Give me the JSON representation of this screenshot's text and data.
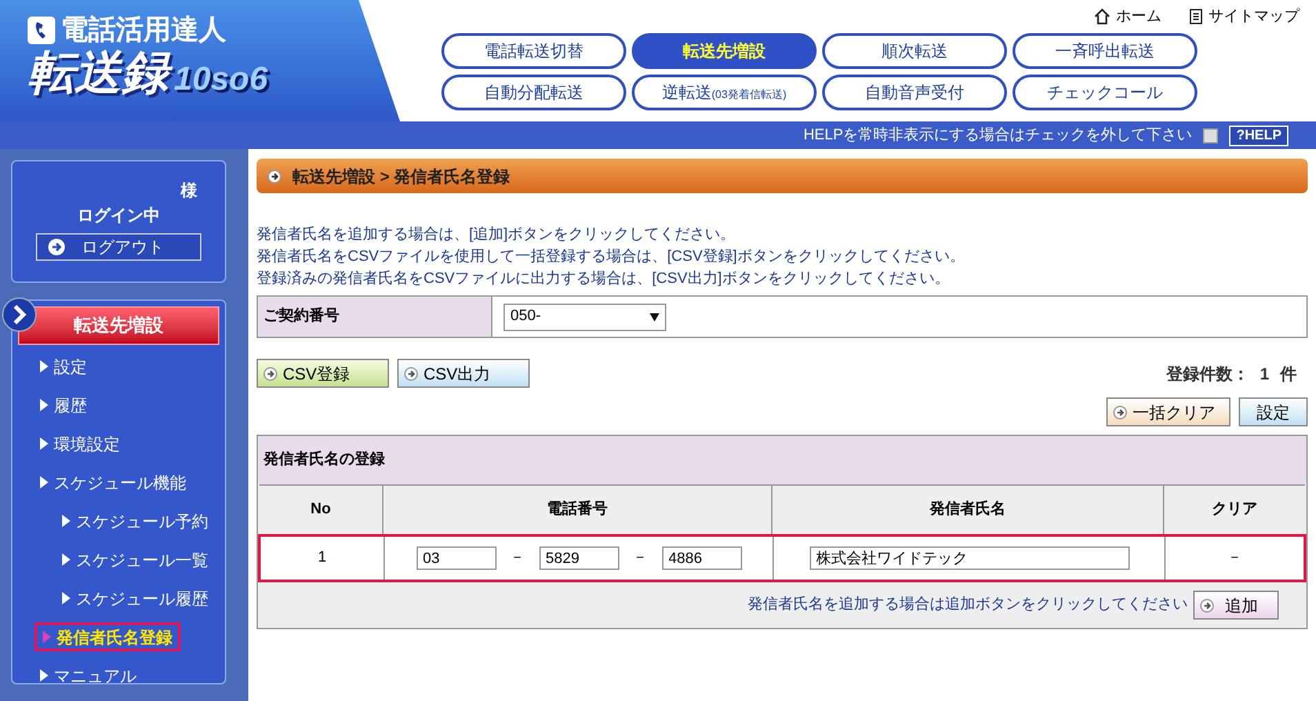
{
  "header": {
    "logo_top": "電話活用達人",
    "logo_main": "転送録",
    "logo_version": "10so6",
    "links": [
      {
        "kind": "home",
        "label": "ホーム"
      },
      {
        "kind": "sitemap",
        "label": "サイトマップ"
      }
    ]
  },
  "nav": [
    {
      "label": "電話転送切替",
      "selected": false
    },
    {
      "label": "転送先増設",
      "selected": true
    },
    {
      "label": "順次転送",
      "selected": false
    },
    {
      "label": "一斉呼出転送",
      "selected": false
    },
    {
      "label": "自動分配転送",
      "selected": false
    },
    {
      "label": "逆転送",
      "note": "(03発着信転送)",
      "selected": false
    },
    {
      "label": "自動音声受付",
      "selected": false
    },
    {
      "label": "チェックコール",
      "selected": false
    }
  ],
  "help_bar": {
    "text": "HELPを常時非表示にする場合はチェックを外して下さい",
    "checked": false,
    "button": "?HELP"
  },
  "sidebar": {
    "user_suffix": "様",
    "status": "ログイン中",
    "logout": "ログアウト",
    "section": "転送先増設",
    "items": [
      {
        "label": "設定",
        "selected": false
      },
      {
        "label": "履歴",
        "selected": false
      },
      {
        "label": "環境設定",
        "selected": false
      },
      {
        "label": "スケジュール機能",
        "selected": false,
        "children": [
          {
            "label": "スケジュール予約",
            "selected": false
          },
          {
            "label": "スケジュール一覧",
            "selected": false
          },
          {
            "label": "スケジュール履歴",
            "selected": false
          }
        ]
      },
      {
        "label": "発信者氏名登録",
        "selected": true
      },
      {
        "label": "マニュアル",
        "selected": false
      }
    ]
  },
  "main": {
    "breadcrumb": "転送先増設 > 発信者氏名登録",
    "instructions": [
      "発信者氏名を追加する場合は、[追加]ボタンをクリックしてください。",
      "発信者氏名をCSVファイルを使用して一括登録する場合は、[CSV登録]ボタンをクリックしてください。",
      "登録済みの発信者氏名をCSVファイルに出力する場合は、[CSV出力]ボタンをクリックしてください。"
    ],
    "contract": {
      "label": "ご契約番号",
      "value": "050-"
    },
    "csv_register": "CSV登録",
    "csv_export": "CSV出力",
    "count_label": "登録件数：",
    "count": "1",
    "count_unit": "件",
    "clear_all": "一括クリア",
    "settings": "設定",
    "registration": {
      "title": "発信者氏名の登録",
      "columns": [
        "No",
        "電話番号",
        "発信者氏名",
        "クリア"
      ],
      "rows": [
        {
          "no": "1",
          "phone": [
            "03",
            "5829",
            "4886"
          ],
          "separator": "－",
          "name": "株式会社ワイドテック",
          "clear": "－",
          "selected": true
        }
      ],
      "footer_text": "発信者氏名を追加する場合は追加ボタンをクリックしてください",
      "add_button": "追加"
    }
  }
}
